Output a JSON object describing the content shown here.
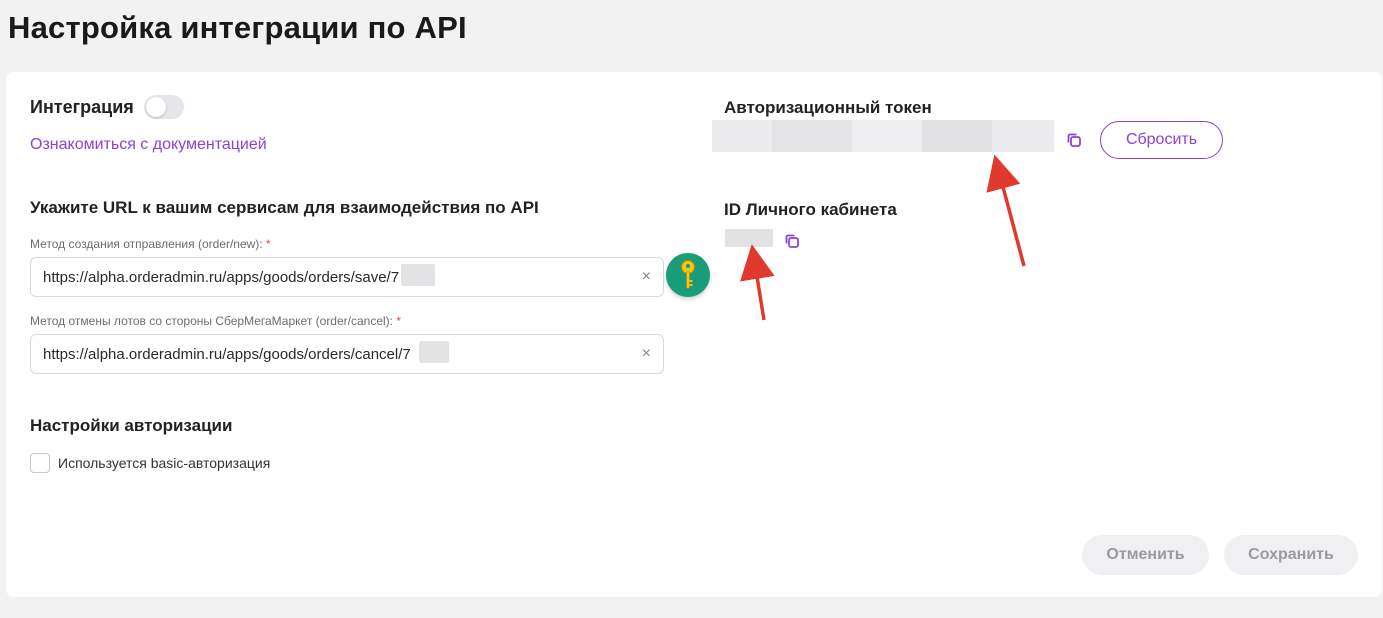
{
  "page": {
    "title": "Настройка интеграции по API"
  },
  "integration": {
    "label": "Интеграция",
    "enabled": false,
    "doc_link": "Ознакомиться с документацией"
  },
  "urls": {
    "heading": "Укажите URL к вашим сервисам для взаимодействия по API",
    "create": {
      "label": "Метод создания отправления (order/new):",
      "required_mark": "*",
      "value": "https://alpha.orderadmin.ru/apps/goods/orders/save/7"
    },
    "cancel": {
      "label": "Метод отмены лотов со стороны СберМегаМаркет (order/cancel):",
      "required_mark": "*",
      "value": "https://alpha.orderadmin.ru/apps/goods/orders/cancel/7"
    },
    "clear_glyph": "×"
  },
  "auth": {
    "heading": "Настройки авторизации",
    "basic_label": "Используется basic-авторизация",
    "basic_checked": false
  },
  "token": {
    "heading": "Авторизационный токен",
    "reset_label": "Сбросить"
  },
  "cabinet": {
    "heading": "ID Личного кабинета"
  },
  "footer": {
    "cancel_label": "Отменить",
    "save_label": "Сохранить"
  },
  "colors": {
    "accent": "#8a43d6",
    "key_button": "#1a9c7a",
    "key_glyph": "#f5c518",
    "arrow": "#e03a2f",
    "required": "#e04848"
  },
  "icons": {
    "copy": "copy-icon",
    "key": "key-icon",
    "clear": "close-icon"
  }
}
